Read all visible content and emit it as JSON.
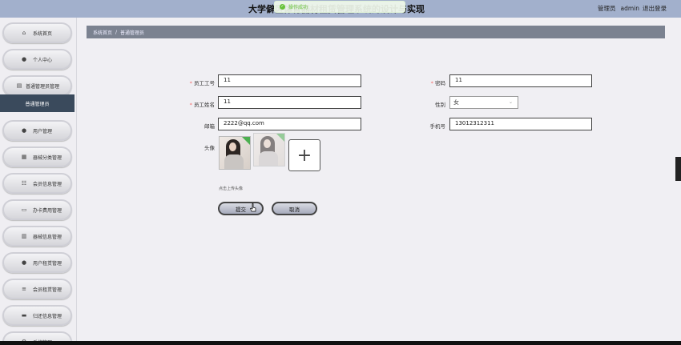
{
  "header": {
    "title": "大学僻区体育器材租赁管理系统的设计与实现",
    "toast": "操作成功",
    "role": "管理员",
    "username": "admin",
    "logout": "退出登录"
  },
  "sidebar": {
    "items": [
      {
        "label": "系统首页",
        "icon": "home-icon",
        "glyph": "⌂"
      },
      {
        "label": "个人中心",
        "icon": "person-icon",
        "glyph": "👤"
      },
      {
        "label": "普通管理员管理",
        "icon": "list-icon",
        "glyph": "▤"
      },
      {
        "label": "用户管理",
        "icon": "user-icon",
        "glyph": "👤"
      },
      {
        "label": "器械分类管理",
        "icon": "grid-icon",
        "glyph": "▦"
      },
      {
        "label": "会员信息管理",
        "icon": "table-icon",
        "glyph": "☷"
      },
      {
        "label": "办卡费用管理",
        "icon": "card-icon",
        "glyph": "▭"
      },
      {
        "label": "器械信息管理",
        "icon": "chart-icon",
        "glyph": "▥"
      },
      {
        "label": "用户租赁管理",
        "icon": "location-icon",
        "glyph": "●"
      },
      {
        "label": "会员租赁管理",
        "icon": "lines-icon",
        "glyph": "≡"
      },
      {
        "label": "归还信息管理",
        "icon": "box-icon",
        "glyph": "▬"
      },
      {
        "label": "系统管理",
        "icon": "gear-icon",
        "glyph": "⚙"
      }
    ],
    "active_sub": "普通管理员"
  },
  "breadcrumb": {
    "home": "系统首页",
    "sep": "/",
    "current": "普通管理员"
  },
  "form": {
    "emp_no_label": "员工工号",
    "emp_no_value": "11",
    "password_label": "密码",
    "password_value": "11",
    "emp_name_label": "员工姓名",
    "emp_name_value": "11",
    "gender_label": "性别",
    "gender_value": "女",
    "email_label": "邮箱",
    "email_value": "2222@qq.com",
    "phone_label": "手机号",
    "phone_value": "13012312311",
    "avatar_label": "头像",
    "upload_hint": "点击上传头像",
    "required_mark": "*"
  },
  "actions": {
    "submit": "提交",
    "cancel": "取消"
  },
  "colors": {
    "topbar": "#a2b0cc",
    "active": "#3a4a5c",
    "breadcrumb": "#7b8290"
  }
}
